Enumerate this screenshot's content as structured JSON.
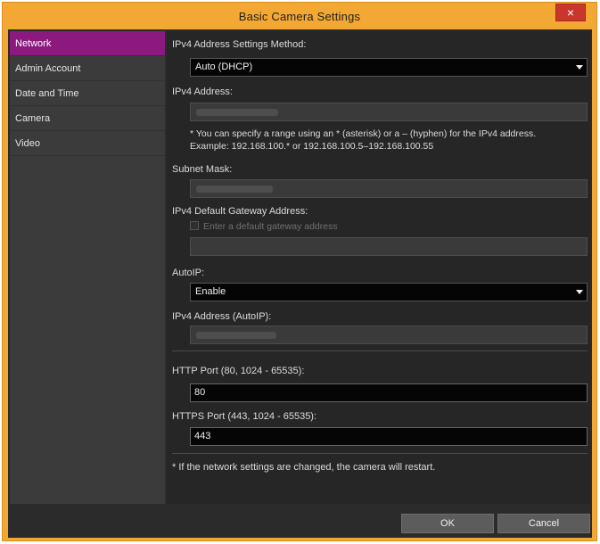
{
  "window": {
    "title": "Basic Camera Settings",
    "close_glyph": "×"
  },
  "sidebar": {
    "items": [
      {
        "label": "Network",
        "active": true
      },
      {
        "label": "Admin Account",
        "active": false
      },
      {
        "label": "Date and Time",
        "active": false
      },
      {
        "label": "Camera",
        "active": false
      },
      {
        "label": "Video",
        "active": false
      }
    ]
  },
  "network": {
    "method_label": "IPv4 Address Settings Method:",
    "method_value": "Auto (DHCP)",
    "ipv4_label": "IPv4 Address:",
    "range_note_line1": "* You can specify a range using an * (asterisk) or a – (hyphen) for the IPv4 address.",
    "range_note_line2": "Example: 192.168.100.* or 192.168.100.5–192.168.100.55",
    "subnet_label": "Subnet Mask:",
    "gateway_label": "IPv4 Default Gateway Address:",
    "gateway_checkbox_label": "Enter a default gateway address",
    "autoip_label": "AutoIP:",
    "autoip_value": "Enable",
    "autoip_address_label": "IPv4 Address (AutoIP):",
    "http_label": "HTTP Port (80, 1024 - 65535):",
    "http_value": "80",
    "https_label": "HTTPS Port (443, 1024 - 65535):",
    "https_value": "443",
    "restart_note": "* If the network settings are changed, the camera will restart."
  },
  "footer": {
    "ok_label": "OK",
    "cancel_label": "Cancel"
  },
  "colors": {
    "title_bar": "#f2a833",
    "active_item": "#8c1a7e",
    "close": "#c9372c"
  }
}
